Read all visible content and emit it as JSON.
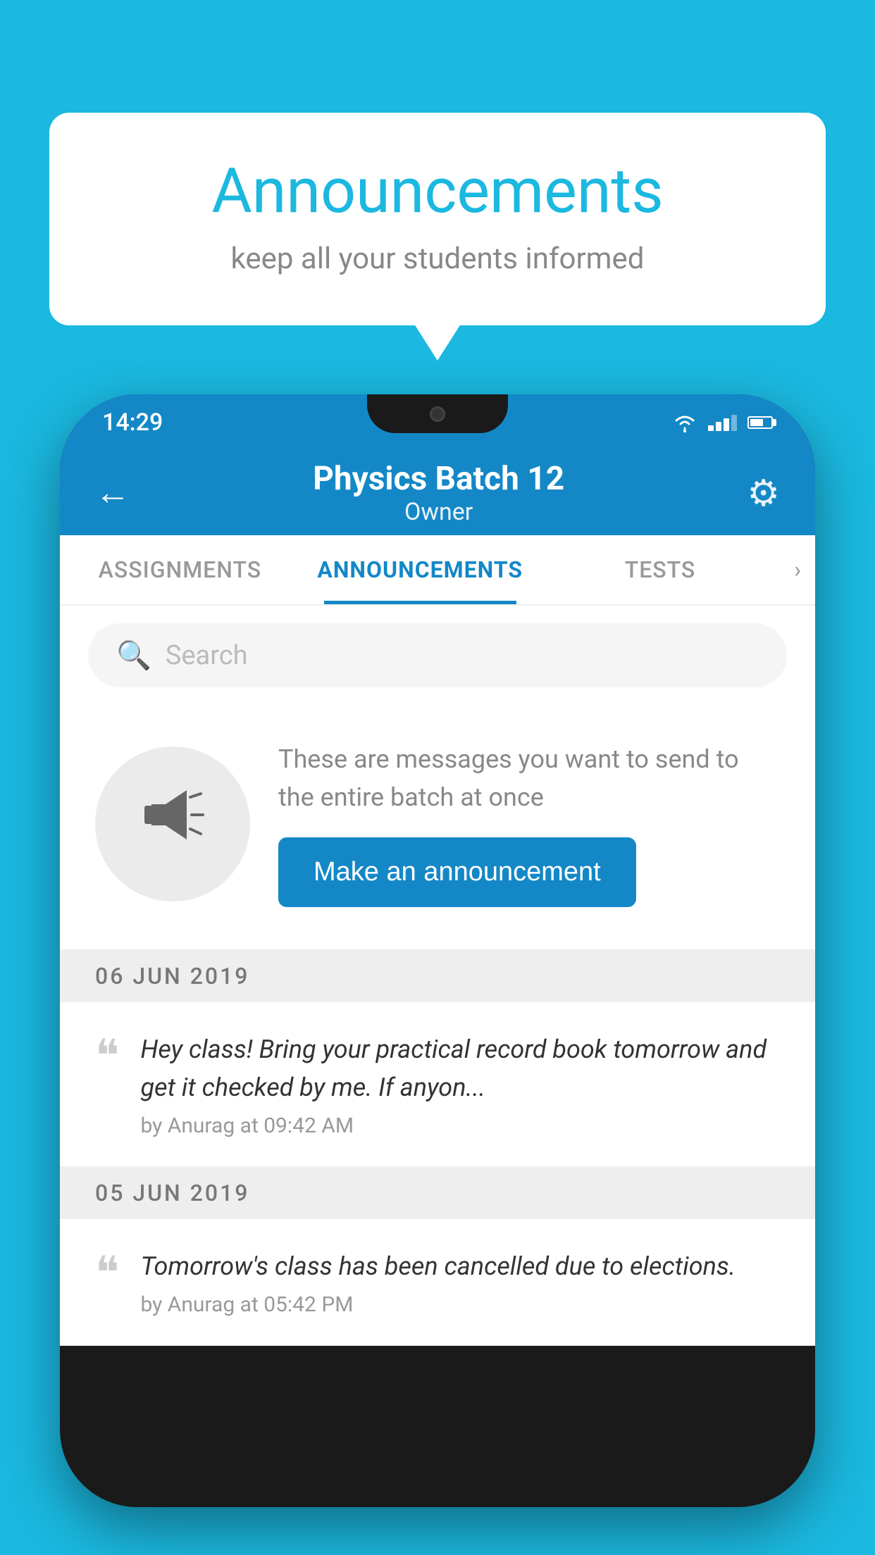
{
  "page": {
    "background_color": "#1bb8e0"
  },
  "bubble": {
    "title": "Announcements",
    "subtitle": "keep all your students informed"
  },
  "status_bar": {
    "time": "14:29"
  },
  "header": {
    "title": "Physics Batch 12",
    "subtitle": "Owner",
    "back_label": "←"
  },
  "tabs": [
    {
      "label": "ASSIGNMENTS",
      "active": false
    },
    {
      "label": "ANNOUNCEMENTS",
      "active": true
    },
    {
      "label": "TESTS",
      "active": false
    }
  ],
  "search": {
    "placeholder": "Search"
  },
  "cta": {
    "description": "These are messages you want to send to the entire batch at once",
    "button_label": "Make an announcement"
  },
  "announcements": [
    {
      "date": "06  JUN  2019",
      "text": "Hey class! Bring your practical record book tomorrow and get it checked by me. If anyon...",
      "meta": "by Anurag at 09:42 AM"
    },
    {
      "date": "05  JUN  2019",
      "text": "Tomorrow's class has been cancelled due to elections.",
      "meta": "by Anurag at 05:42 PM"
    }
  ]
}
